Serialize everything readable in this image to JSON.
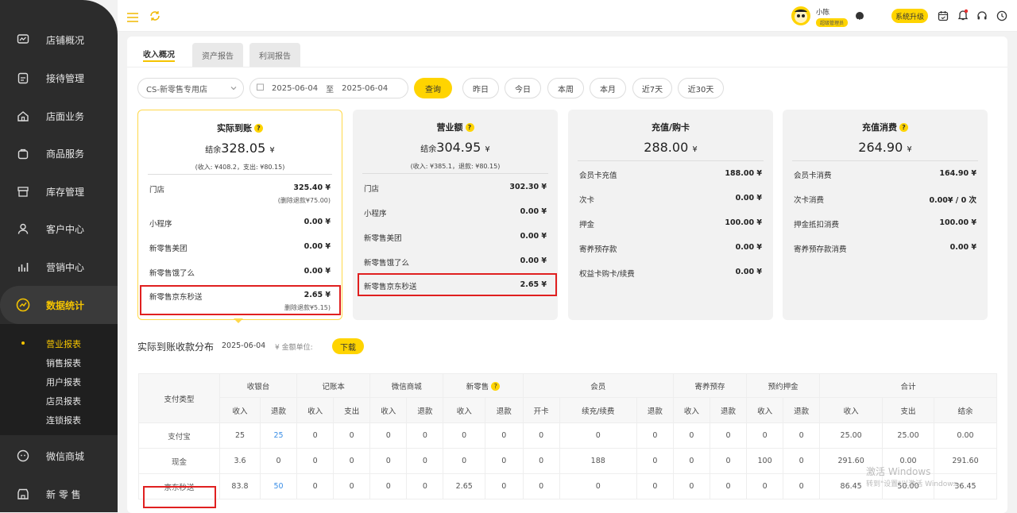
{
  "sidebar": {
    "items": [
      {
        "label": "店铺概况",
        "icon": "monitor-icon"
      },
      {
        "label": "接待管理",
        "icon": "clipboard-icon"
      },
      {
        "label": "店面业务",
        "icon": "home-icon"
      },
      {
        "label": "商品服务",
        "icon": "bag-icon"
      },
      {
        "label": "库存管理",
        "icon": "box-icon"
      },
      {
        "label": "客户中心",
        "icon": "user-icon"
      },
      {
        "label": "营销中心",
        "icon": "chart-bars-icon"
      },
      {
        "label": "数据统计",
        "icon": "trend-icon"
      },
      {
        "label": "微信商城",
        "icon": "wechat-icon"
      },
      {
        "label": "新 零 售",
        "icon": "store-icon"
      }
    ],
    "sub_items": [
      "营业报表",
      "销售报表",
      "用户报表",
      "店员报表",
      "连锁报表"
    ]
  },
  "topbar": {
    "user_name": "小陈",
    "user_role": "超级管理员",
    "upgrade_label": "系统升级"
  },
  "tabs": [
    "收入概况",
    "资产报告",
    "利润报告"
  ],
  "filters": {
    "store": "CS-新零售专用店",
    "date_from": "2025-06-04",
    "date_sep": "至",
    "date_to": "2025-06-04",
    "query_label": "查询",
    "quick": [
      "昨日",
      "今日",
      "本周",
      "本月",
      "近7天",
      "近30天"
    ]
  },
  "cards": [
    {
      "title": "实际到账",
      "amount_prefix": "结余",
      "amount": "328.05",
      "unit": "¥",
      "sub": "(收入: ¥408.2，支出: ¥80.15)",
      "rows": [
        {
          "label": "门店",
          "value": "325.40 ¥",
          "note": "(删除退款¥75.00)"
        },
        {
          "label": "小程序",
          "value": "0.00 ¥",
          "note": ""
        },
        {
          "label": "新零售美团",
          "value": "0.00 ¥",
          "note": ""
        },
        {
          "label": "新零售饿了么",
          "value": "0.00 ¥",
          "note": ""
        },
        {
          "label": "新零售京东秒送",
          "value": "2.65 ¥",
          "note": "删除退款¥5.15)"
        }
      ]
    },
    {
      "title": "营业额",
      "amount_prefix": "结余",
      "amount": "304.95",
      "unit": "¥",
      "sub": "(收入: ¥385.1，退款: ¥80.15)",
      "rows": [
        {
          "label": "门店",
          "value": "302.30 ¥"
        },
        {
          "label": "小程序",
          "value": "0.00 ¥"
        },
        {
          "label": "新零售美团",
          "value": "0.00 ¥"
        },
        {
          "label": "新零售饿了么",
          "value": "0.00 ¥"
        },
        {
          "label": "新零售京东秒送",
          "value": "2.65 ¥"
        }
      ]
    },
    {
      "title": "充值/购卡",
      "amount": "288.00",
      "unit": "¥",
      "rows": [
        {
          "label": "会员卡充值",
          "value": "188.00 ¥"
        },
        {
          "label": "次卡",
          "value": "0.00 ¥"
        },
        {
          "label": "押金",
          "value": "100.00 ¥"
        },
        {
          "label": "寄养预存款",
          "value": "0.00 ¥"
        },
        {
          "label": "权益卡购卡/续费",
          "value": "0.00 ¥"
        }
      ]
    },
    {
      "title": "充值消费",
      "amount": "264.90",
      "unit": "¥",
      "rows": [
        {
          "label": "会员卡消费",
          "value": "164.90 ¥"
        },
        {
          "label": "次卡消费",
          "value": "0.00¥ / 0 次"
        },
        {
          "label": "押金抵扣消费",
          "value": "100.00 ¥"
        },
        {
          "label": "寄养预存款消费",
          "value": "0.00 ¥"
        }
      ]
    }
  ],
  "section": {
    "title": "实际到账收款分布",
    "date": "2025-06-04",
    "unit_label": "¥ 金额单位:",
    "download_label": "下载"
  },
  "table": {
    "type_header": "支付类型",
    "groups": [
      "收银台",
      "记账本",
      "微信商城",
      "新零售",
      "会员",
      "寄养预存",
      "预约押金",
      "合计"
    ],
    "subheaders": [
      "收入",
      "退款",
      "收入",
      "支出",
      "收入",
      "退款",
      "收入",
      "退款",
      "开卡",
      "续充/续费",
      "退款",
      "收入",
      "退款",
      "收入",
      "退款",
      "收入",
      "支出",
      "结余"
    ],
    "rows": [
      {
        "type": "支付宝",
        "cells": [
          "25",
          "25",
          "0",
          "0",
          "0",
          "0",
          "0",
          "0",
          "0",
          "0",
          "0",
          "0",
          "0",
          "0",
          "0",
          "25.00",
          "25.00",
          "0.00"
        ]
      },
      {
        "type": "现金",
        "cells": [
          "3.6",
          "0",
          "0",
          "0",
          "0",
          "0",
          "0",
          "0",
          "0",
          "188",
          "0",
          "0",
          "0",
          "100",
          "0",
          "291.60",
          "0.00",
          "291.60"
        ]
      },
      {
        "type": "京东秒送",
        "cells": [
          "83.8",
          "50",
          "0",
          "0",
          "0",
          "0",
          "2.65",
          "0",
          "0",
          "0",
          "0",
          "0",
          "0",
          "0",
          "0",
          "86.45",
          "50.00",
          "36.45"
        ]
      }
    ]
  },
  "watermark": {
    "line1": "激活 Windows",
    "line2": "转到\"设置\"以激活 Windows。"
  }
}
